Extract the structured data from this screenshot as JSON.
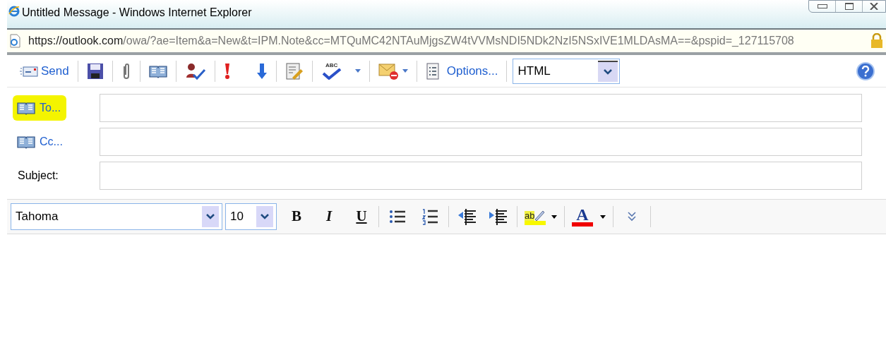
{
  "window": {
    "title": "Untitled Message - Windows Internet Explorer"
  },
  "address_bar": {
    "host": "https://outlook.com",
    "path": "/owa/?ae=Item&a=New&t=IPM.Note&cc=MTQuMC42NTAuMjgsZW4tVVMsNDI5NDk2NzI5NSxIVE1MLDAsMA==&pspid=_127115708"
  },
  "toolbar": {
    "send": "Send",
    "spell_label": "ABC",
    "options": "Options...",
    "format": "HTML"
  },
  "recipients": [
    {
      "label": "To...",
      "highlighted": true
    },
    {
      "label": "Cc...",
      "highlighted": false
    }
  ],
  "subject": {
    "label": "Subject:"
  },
  "formatting": {
    "font": "Tahoma",
    "size": "10",
    "bold": "B",
    "italic": "I",
    "underline": "U",
    "highlight_label": "ab",
    "color_label": "A"
  }
}
